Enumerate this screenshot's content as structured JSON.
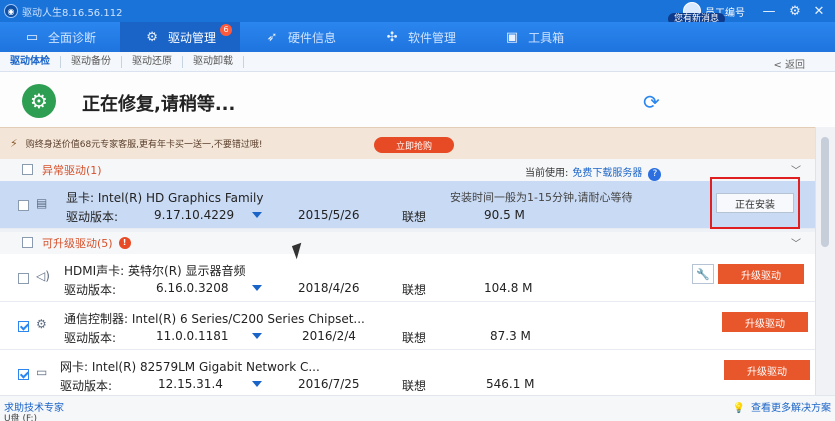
{
  "titlebar": {
    "title": "驱动人生8.16.56.112",
    "user_name": "员工编号",
    "message_badge": "您有新消息",
    "minimize": "—",
    "settings": "⚙",
    "close": "✕"
  },
  "mainnav": {
    "items": [
      {
        "label": "全面诊断",
        "icon": "monitor-icon"
      },
      {
        "label": "驱动管理",
        "icon": "gear-icon",
        "badge": "6"
      },
      {
        "label": "硬件信息",
        "icon": "rocket-icon"
      },
      {
        "label": "软件管理",
        "icon": "apps-icon"
      },
      {
        "label": "工具箱",
        "icon": "toolbox-icon"
      }
    ]
  },
  "subnav": {
    "tabs": [
      "驱动体检",
      "驱动备份",
      "驱动还原",
      "驱动卸载"
    ],
    "back": "< 返回"
  },
  "status": {
    "title": "正在修复,请稍等..."
  },
  "promo": {
    "text": "购终身送价值68元专家客服,更有年卡买一送一,不要错过哦!",
    "button": "立即抢购"
  },
  "sections": {
    "abnormal": {
      "label": "异常驱动(1)",
      "server_prefix": "当前使用:",
      "server_name": "免费下载服务器",
      "help": "?"
    },
    "upgradable": {
      "label": "可升级驱动(5)",
      "badge": "!"
    }
  },
  "rows": [
    {
      "name": "显卡: Intel(R) HD Graphics Family",
      "version_label": "驱动版本:",
      "version": "9.17.10.4229",
      "date": "2015/5/26",
      "vendor": "联想",
      "size": "90.5 M",
      "note": "安装时间一般为1-15分钟,请耐心等待",
      "action": "正在安装"
    },
    {
      "name": "HDMI声卡: 英特尔(R) 显示器音频",
      "version_label": "驱动版本:",
      "version": "6.16.0.3208",
      "date": "2018/4/26",
      "vendor": "联想",
      "size": "104.8 M",
      "action": "升级驱动"
    },
    {
      "name": "通信控制器: Intel(R) 6 Series/C200 Series Chipset...",
      "version_label": "驱动版本:",
      "version": "11.0.0.1181",
      "date": "2016/2/4",
      "vendor": "联想",
      "size": "87.3 M",
      "action": "升级驱动"
    },
    {
      "name": "网卡: Intel(R) 82579LM Gigabit Network C...",
      "version_label": "驱动版本:",
      "version": "12.15.31.4",
      "date": "2016/7/25",
      "vendor": "联想",
      "size": "546.1 M",
      "action": "升级驱动"
    }
  ],
  "footer": {
    "left": "求助技术专家",
    "drive": "U盘 (F:)",
    "right": "查看更多解决方案"
  },
  "colors": {
    "primary": "#2b86ef",
    "accent": "#e8572b",
    "highlight_row": "#c9daf4",
    "frame": "#e02020"
  }
}
